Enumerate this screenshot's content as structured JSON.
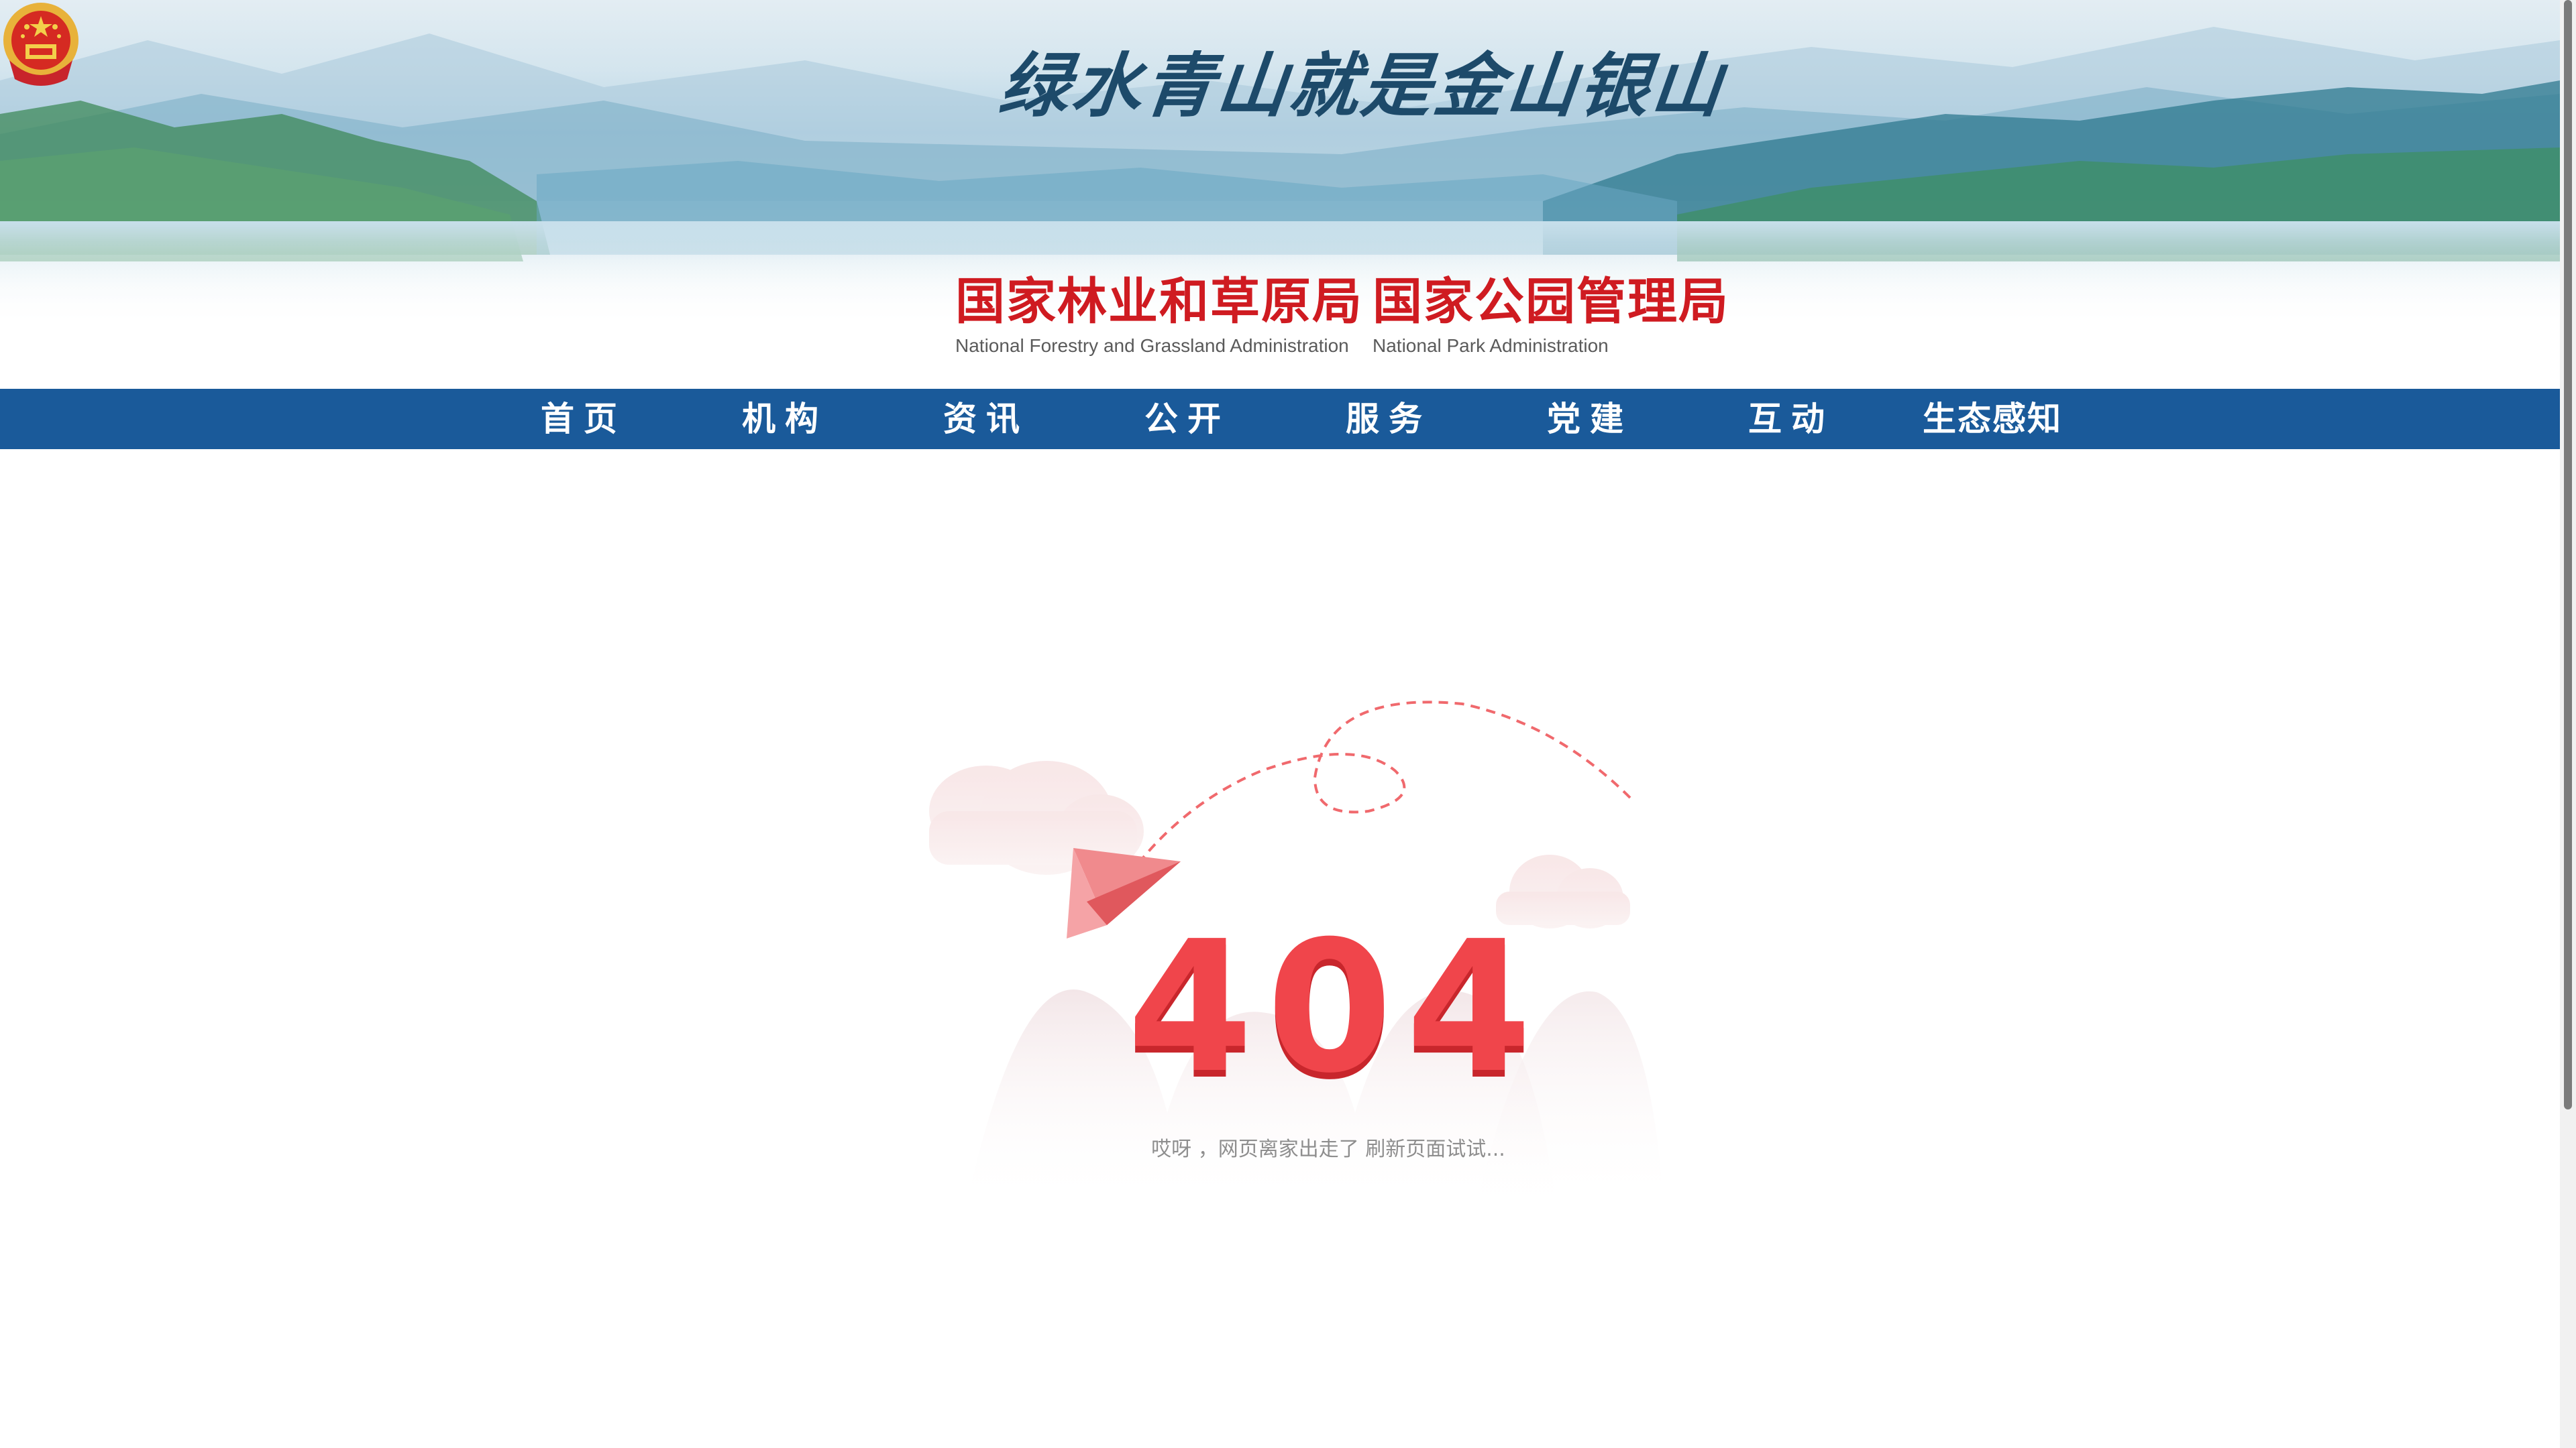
{
  "banner": {
    "slogan": "绿水青山就是金山银山",
    "org1_cn": "国家林业和草原局",
    "org1_en": "National Forestry and Grassland Administration",
    "org2_cn": "国家公园管理局",
    "org2_en": "National  Park  Administration"
  },
  "nav": {
    "items": [
      {
        "label": "首页"
      },
      {
        "label": "机构"
      },
      {
        "label": "资讯"
      },
      {
        "label": "公开"
      },
      {
        "label": "服务"
      },
      {
        "label": "党建"
      },
      {
        "label": "互动"
      },
      {
        "label": "生态感知"
      }
    ]
  },
  "error": {
    "code": "404",
    "message": "哎呀 ，网页离家出走了 刷新页面试试..."
  },
  "colors": {
    "nav_bg": "#1a5a9a",
    "title_red": "#cf1b21",
    "code_red": "#f0454b"
  },
  "icons": {
    "emblem": "national-emblem-icon",
    "plane": "paper-plane-icon"
  }
}
